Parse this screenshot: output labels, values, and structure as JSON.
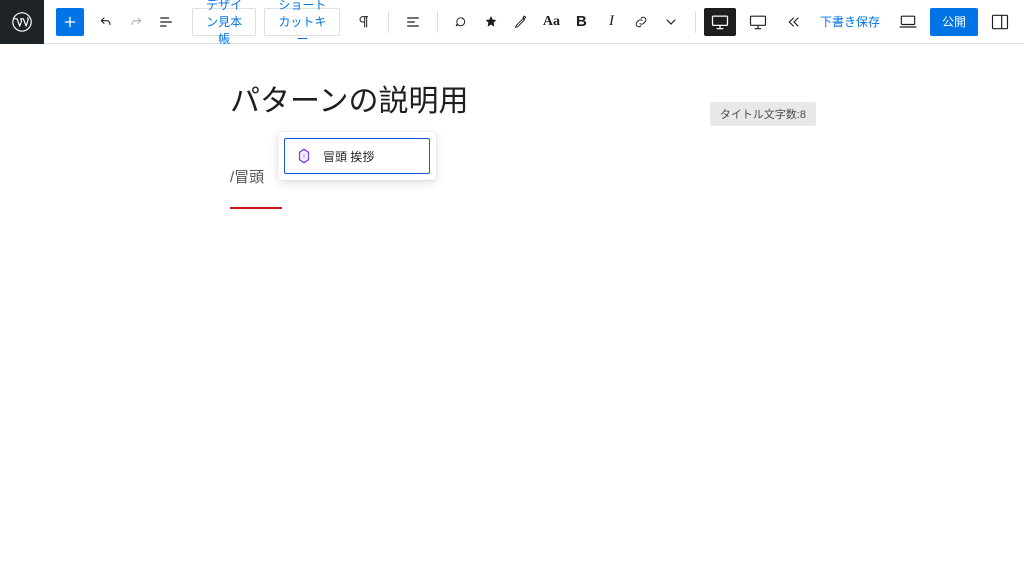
{
  "toolbar": {
    "design_sample": "デザイン見本帳",
    "shortcut_keys": "ショートカットキー",
    "draft_save": "下書き保存",
    "publish": "公開"
  },
  "editor": {
    "title_text": "パターンの説明用",
    "slash_text": "/冒頭",
    "count_label": "タイトル文字数:8"
  },
  "autocomplete": {
    "item_label": "冒頭 挨拶"
  }
}
